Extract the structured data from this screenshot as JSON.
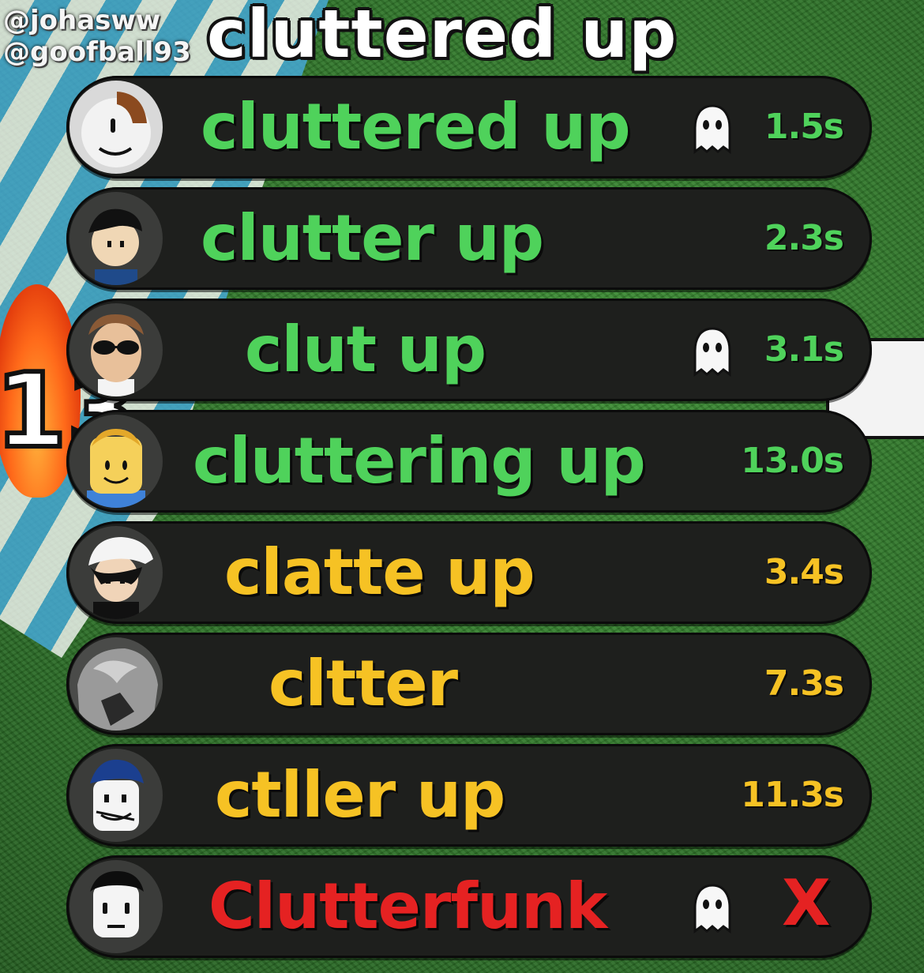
{
  "credits": [
    "@johasww",
    "@goofball93"
  ],
  "title": "cluttered up",
  "background_number": "13",
  "colors": {
    "green": "#4fd25b",
    "yellow": "#f6c224",
    "red": "#e52222",
    "row_bg": "#1e1f1d"
  },
  "entries": [
    {
      "word": "cluttered up",
      "time": "1.5s",
      "color": "green",
      "ghost": true,
      "avatar": "classic-face-brown-hair"
    },
    {
      "word": "clutter up",
      "time": "2.3s",
      "color": "green",
      "ghost": false,
      "avatar": "black-hair-boy"
    },
    {
      "word": "clut up",
      "time": "3.1s",
      "color": "green",
      "ghost": true,
      "avatar": "sunglasses-face"
    },
    {
      "word": "cluttering up",
      "time": "13.0s",
      "color": "green",
      "ghost": false,
      "avatar": "blond-smile-face"
    },
    {
      "word": "clatte up",
      "time": "3.4s",
      "color": "yellow",
      "ghost": false,
      "avatar": "white-cap-face"
    },
    {
      "word": "cltter",
      "time": "7.3s",
      "color": "yellow",
      "ghost": false,
      "avatar": "grey-hair-silhouette"
    },
    {
      "word": "ctller up",
      "time": "11.3s",
      "color": "yellow",
      "ghost": false,
      "avatar": "blue-hair-face"
    },
    {
      "word": "Clutterfunk",
      "time": "X",
      "color": "red",
      "ghost": true,
      "avatar": "plain-face-black-hair"
    }
  ]
}
